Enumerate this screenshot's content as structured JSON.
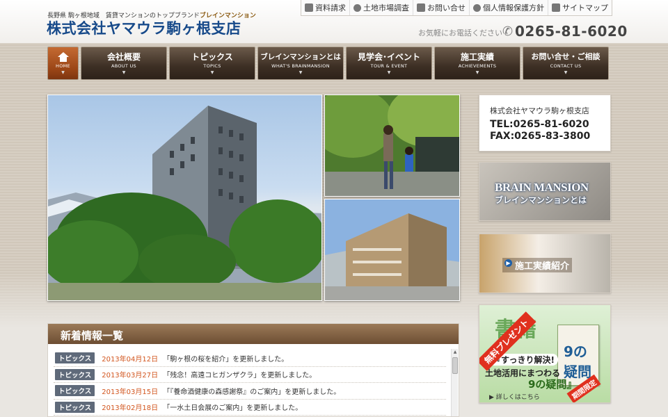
{
  "header": {
    "tagline_region": "長野県 駒ヶ根地域　",
    "tagline_brand": "賃貸マンションのトップブランド",
    "tagline_product": "ブレインマンション",
    "site_name": "株式会社ヤマウラ駒ヶ根支店",
    "phone_lead": "お気軽にお電話ください",
    "phone": "0265-81-6020"
  },
  "utility_nav": [
    {
      "label": "資料請求",
      "icon": "document-icon"
    },
    {
      "label": "土地市場調査",
      "icon": "magnifier-icon"
    },
    {
      "label": "お問い合せ",
      "icon": "mail-icon"
    },
    {
      "label": "個人情報保護方針",
      "icon": "person-icon"
    },
    {
      "label": "サイトマップ",
      "icon": "sitemap-icon"
    }
  ],
  "global_nav": {
    "home": {
      "label": "HOME",
      "icon": "house-icon"
    },
    "items": [
      {
        "ja": "会社概要",
        "en": "ABOUT US"
      },
      {
        "ja": "トピックス",
        "en": "TOPICS"
      },
      {
        "ja": "ブレインマンションとは",
        "en": "WHAT'S BRAINMANSION"
      },
      {
        "ja": "見学会･イベント",
        "en": "TOUR & EVENT"
      },
      {
        "ja": "施工実績",
        "en": "ACHIEVEMENTS"
      },
      {
        "ja": "お問い合せ・ご相談",
        "en": "CONTACT US"
      }
    ]
  },
  "sidebar": {
    "contact": {
      "company": "株式会社ヤマウラ駒ヶ根支店",
      "tel": "TEL:0265-81-6020",
      "fax": "FAX:0265-83-3800"
    },
    "brain_banner": {
      "en": "BRAIN MANSION",
      "ja": "ブレインマンションとは"
    },
    "works_banner": {
      "label": "施工実績紹介"
    },
    "present_banner": {
      "ribbon": "無料プレゼント",
      "headline": "書籍",
      "sub1": "『すっきり解決!",
      "sub2": "土地活用にまつわる",
      "sub3": "9の疑問』",
      "more": "詳しくはこちら",
      "book": "9の疑問",
      "limited": "期間限定"
    }
  },
  "news": {
    "title": "新着情報一覧",
    "items": [
      {
        "category": "トピックス",
        "date": "2013年04月12日",
        "text": "「駒ヶ根の桜を紹介」を更新しました。"
      },
      {
        "category": "トピックス",
        "date": "2013年03月27日",
        "text": "「残念！高遠コヒガンザクラ」を更新しました。"
      },
      {
        "category": "トピックス",
        "date": "2013年03月15日",
        "text": "「『養命酒健康の森感謝祭』のご案内」を更新しました。"
      },
      {
        "category": "トピックス",
        "date": "2013年02月18日",
        "text": "「一水土日会展のご案内」を更新しました。"
      }
    ]
  },
  "colors": {
    "site_name": "#174a8a",
    "nav_bg": "#3d2f24",
    "home_bg": "#9a4516",
    "news_date": "#d2551d",
    "news_category_bg": "#5f6a7a"
  }
}
